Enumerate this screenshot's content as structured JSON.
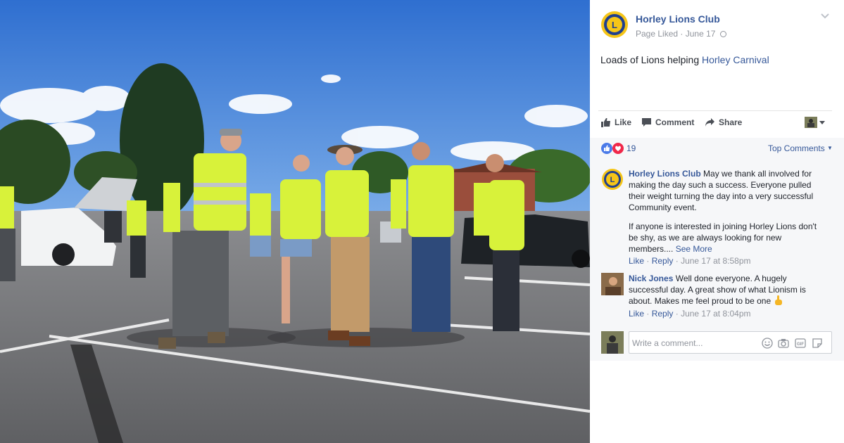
{
  "page": {
    "name": "Horley Lions Club",
    "liked_label": "Page Liked",
    "date": "June 17"
  },
  "post": {
    "text": "Loads of Lions helping ",
    "link_text": "Horley Carnival"
  },
  "actions": {
    "like": "Like",
    "comment": "Comment",
    "share": "Share"
  },
  "reactions": {
    "count": "19",
    "sort_label": "Top Comments"
  },
  "comments": [
    {
      "author": "Horley Lions Club",
      "text": "May we thank all involved for making the day such a success. Everyone pulled their weight turning the day into a very successful Community event.",
      "text2": "If anyone is interested in joining Horley Lions don't be shy, as we are always looking for new members....",
      "see_more": "See More",
      "like": "Like",
      "reply": "Reply",
      "time": "June 17 at 8:58pm"
    },
    {
      "author": "Nick Jones",
      "text": "Well done everyone. A hugely successful day. A great show of what Lionism is about. Makes me feel proud to be one",
      "like": "Like",
      "reply": "Reply",
      "time": "June 17 at 8:04pm"
    }
  ],
  "composer": {
    "placeholder": "Write a comment..."
  },
  "colors": {
    "link": "#365899",
    "meta": "#90949c",
    "vest": "#d8f23a",
    "sky": "#3d7fd6"
  }
}
